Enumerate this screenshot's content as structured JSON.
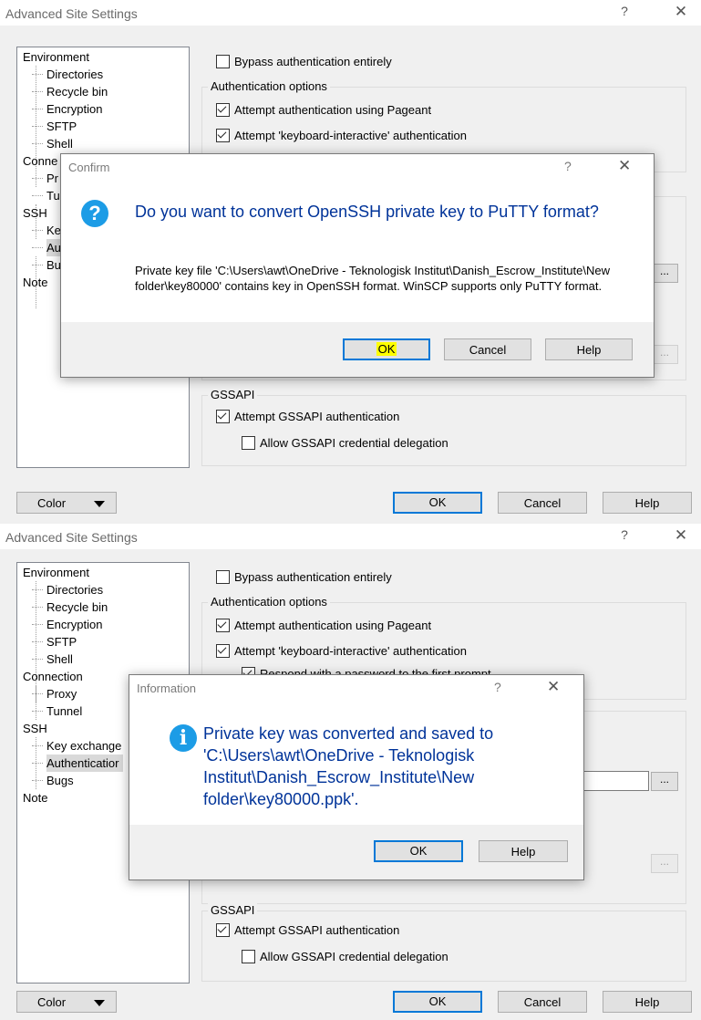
{
  "screens": [
    {
      "window": {
        "title": "Advanced Site Settings",
        "help": "?",
        "close": "✕"
      },
      "tree": [
        {
          "label": "Environment"
        },
        {
          "label": "Directories"
        },
        {
          "label": "Recycle bin"
        },
        {
          "label": "Encryption"
        },
        {
          "label": "SFTP"
        },
        {
          "label": "Shell"
        },
        {
          "label": "Conne"
        },
        {
          "label": "Pr"
        },
        {
          "label": "Tu"
        },
        {
          "label": "SSH"
        },
        {
          "label": "Ke"
        },
        {
          "label": "Au"
        },
        {
          "label": "Bu"
        },
        {
          "label": "Note"
        }
      ],
      "bypass_label": "Bypass authentication entirely",
      "auth_options_title": "Authentication options",
      "pageant_label": "Attempt authentication using Pageant",
      "kbdint_label": "Attempt 'keyboard-interactive' authentication",
      "gssapi_title": "GSSAPI",
      "gssapi_label": "Attempt GSSAPI authentication",
      "gssapi_deleg_label": "Allow GSSAPI credential delegation",
      "ellipsis": "...",
      "buttons": {
        "color": "Color",
        "ok": "OK",
        "cancel": "Cancel",
        "help": "Help"
      },
      "dialog": {
        "title": "Confirm",
        "help": "?",
        "close": "✕",
        "icon": "?",
        "main_instruction": "Do you want to convert OpenSSH private key to PuTTY format?",
        "content": "Private key file 'C:\\Users\\awt\\OneDrive - Teknologisk Institut\\Danish_Escrow_Institute\\New folder\\key80000' contains key in OpenSSH format. WinSCP supports only PuTTY format.",
        "buttons": {
          "ok": "OK",
          "cancel": "Cancel",
          "help": "Help"
        }
      }
    },
    {
      "window": {
        "title": "Advanced Site Settings",
        "help": "?",
        "close": "✕"
      },
      "tree": [
        {
          "label": "Environment"
        },
        {
          "label": "Directories"
        },
        {
          "label": "Recycle bin"
        },
        {
          "label": "Encryption"
        },
        {
          "label": "SFTP"
        },
        {
          "label": "Shell"
        },
        {
          "label": "Connection"
        },
        {
          "label": "Proxy"
        },
        {
          "label": "Tunnel"
        },
        {
          "label": "SSH"
        },
        {
          "label": "Key exchange"
        },
        {
          "label": "Authenticatior"
        },
        {
          "label": "Bugs"
        },
        {
          "label": "Note"
        }
      ],
      "bypass_label": "Bypass authentication entirely",
      "auth_options_title": "Authentication options",
      "pageant_label": "Attempt authentication using Pageant",
      "kbdint_label": "Attempt 'keyboard-interactive' authentication",
      "respond_label": "Respond with a password to the first prompt",
      "gssapi_title": "GSSAPI",
      "gssapi_label": "Attempt GSSAPI authentication",
      "gssapi_deleg_label": "Allow GSSAPI credential delegation",
      "ellipsis": "...",
      "buttons": {
        "color": "Color",
        "ok": "OK",
        "cancel": "Cancel",
        "help": "Help"
      },
      "dialog": {
        "title": "Information",
        "help": "?",
        "close": "✕",
        "icon": "i",
        "main_instruction": "Private key was converted and saved to 'C:\\Users\\awt\\OneDrive - Teknologisk Institut\\Danish_Escrow_Institute\\New folder\\key80000.ppk'.",
        "buttons": {
          "ok": "OK",
          "help": "Help"
        }
      }
    }
  ]
}
